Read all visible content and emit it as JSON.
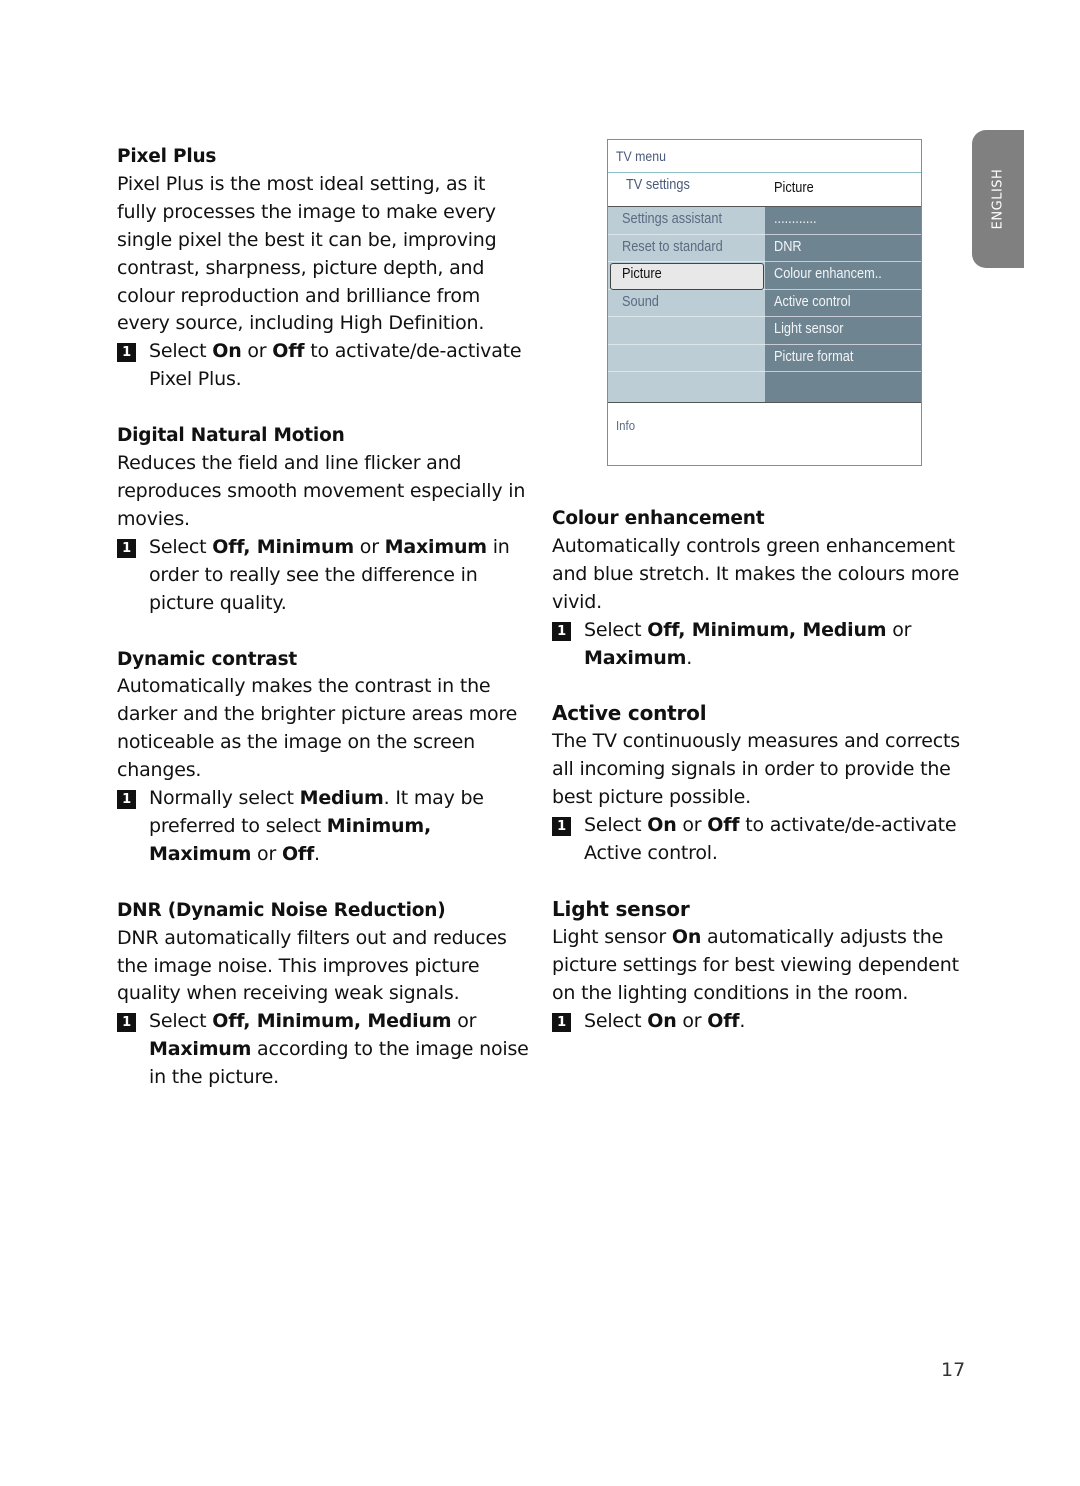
{
  "language_tab": "ENGLISH",
  "page_number": "17",
  "tv_menu": {
    "title": "TV menu",
    "breadcrumb": "TV settings",
    "submenu_header": "Picture",
    "left_items": [
      {
        "label": "Settings assistant",
        "selected": false
      },
      {
        "label": "Reset to standard",
        "selected": false
      },
      {
        "label": "Picture",
        "selected": true
      },
      {
        "label": "Sound",
        "selected": false
      },
      {
        "label": "",
        "selected": false
      },
      {
        "label": "",
        "selected": false
      },
      {
        "label": "",
        "selected": false
      }
    ],
    "right_items": [
      "............",
      "DNR",
      "Colour enhancem..",
      "Active control",
      "Light sensor",
      "Picture format",
      ""
    ],
    "info_label": "Info",
    "colors": {
      "left_panel": "#bccdd5",
      "right_panel": "#6e8490",
      "selected_bg": "#e8e8e8"
    }
  },
  "sections_left": [
    {
      "heading": "Pixel Plus",
      "body": "Pixel Plus is the most ideal setting, as it fully processes the image to make every single pixel the best it can be, improving contrast, sharpness, picture depth, and colour reproduction and brilliance from every source, including High Definition.",
      "step_number": "1",
      "step_parts": [
        {
          "t": "Select ",
          "b": false
        },
        {
          "t": "On",
          "b": true
        },
        {
          "t": " or ",
          "b": false
        },
        {
          "t": "Off",
          "b": true
        },
        {
          "t": " to activate/de-activate Pixel Plus.",
          "b": false
        }
      ]
    },
    {
      "heading": "Digital Natural Motion",
      "body": "Reduces the field and line flicker and reproduces smooth movement especially in movies.",
      "step_number": "1",
      "step_parts": [
        {
          "t": "Select ",
          "b": false
        },
        {
          "t": "Off, Minimum",
          "b": true
        },
        {
          "t": " or ",
          "b": false
        },
        {
          "t": "Maximum",
          "b": true
        },
        {
          "t": " in order to really see the difference in picture quality.",
          "b": false
        }
      ]
    },
    {
      "heading": "Dynamic contrast",
      "body": "Automatically makes the contrast in the darker and the brighter picture areas more noticeable as the image on the screen changes.",
      "step_number": "1",
      "step_parts": [
        {
          "t": "Normally select ",
          "b": false
        },
        {
          "t": "Medium",
          "b": true
        },
        {
          "t": ". It may be preferred to select ",
          "b": false
        },
        {
          "t": "Minimum, Maximum",
          "b": true
        },
        {
          "t": " or ",
          "b": false
        },
        {
          "t": "Off",
          "b": true
        },
        {
          "t": ".",
          "b": false
        }
      ]
    },
    {
      "heading": "DNR (Dynamic Noise Reduction)",
      "body": "DNR automatically filters out and reduces the image noise. This improves picture quality when receiving weak signals.",
      "step_number": "1",
      "step_parts": [
        {
          "t": "Select ",
          "b": false
        },
        {
          "t": "Off, Minimum, Medium",
          "b": true
        },
        {
          "t": " or ",
          "b": false
        },
        {
          "t": "Maximum",
          "b": true
        },
        {
          "t": " according to the image noise in the picture.",
          "b": false
        }
      ]
    }
  ],
  "sections_right": [
    {
      "heading": "Colour enhancement",
      "body_parts": [
        {
          "t": "Automatically controls green enhancement and blue stretch. It makes the colours more vivid.",
          "b": false
        }
      ],
      "step_number": "1",
      "step_parts": [
        {
          "t": "Select ",
          "b": false
        },
        {
          "t": "Off, Minimum, Medium",
          "b": true
        },
        {
          "t": " or ",
          "b": false
        },
        {
          "t": "Maximum",
          "b": true
        },
        {
          "t": ".",
          "b": false
        }
      ]
    },
    {
      "heading": "Active control",
      "body_parts": [
        {
          "t": "The TV continuously measures and corrects all incoming signals in order to provide the best picture possible.",
          "b": false
        }
      ],
      "step_number": "1",
      "step_parts": [
        {
          "t": "Select ",
          "b": false
        },
        {
          "t": "On",
          "b": true
        },
        {
          "t": " or ",
          "b": false
        },
        {
          "t": "Off",
          "b": true
        },
        {
          "t": " to activate/de-activate Active control.",
          "b": false
        }
      ]
    },
    {
      "heading": "Light sensor",
      "body_parts": [
        {
          "t": "Light sensor ",
          "b": false
        },
        {
          "t": "On",
          "b": true
        },
        {
          "t": " automatically adjusts the picture settings for best viewing dependent on the lighting conditions in the room.",
          "b": false
        }
      ],
      "step_number": "1",
      "step_parts": [
        {
          "t": "Select ",
          "b": false
        },
        {
          "t": "On",
          "b": true
        },
        {
          "t": " or ",
          "b": false
        },
        {
          "t": "Off",
          "b": true
        },
        {
          "t": ".",
          "b": false
        }
      ]
    }
  ]
}
